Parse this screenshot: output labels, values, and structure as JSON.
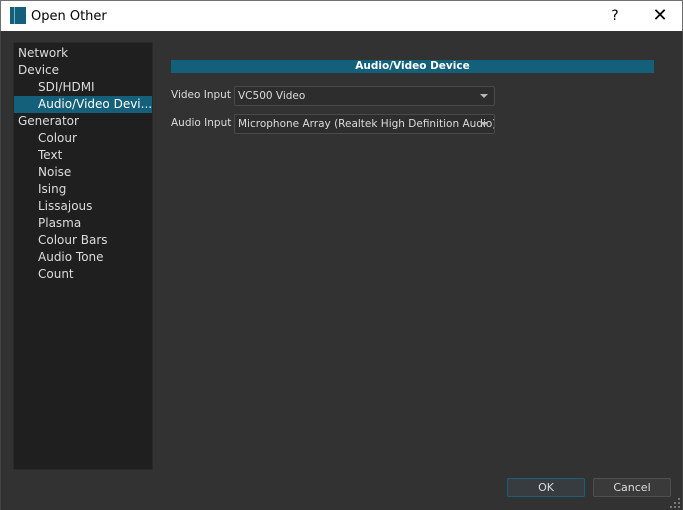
{
  "window": {
    "title": "Open Other",
    "help_label": "?",
    "close_label": "✕",
    "icon": "app-book-icon"
  },
  "tree": {
    "items": [
      {
        "label": "Network",
        "level": 0,
        "selected": false
      },
      {
        "label": "Device",
        "level": 0,
        "selected": false
      },
      {
        "label": "SDI/HDMI",
        "level": 1,
        "selected": false
      },
      {
        "label": "Audio/Video Devi...",
        "level": 1,
        "selected": true
      },
      {
        "label": "Generator",
        "level": 0,
        "selected": false
      },
      {
        "label": "Colour",
        "level": 1,
        "selected": false
      },
      {
        "label": "Text",
        "level": 1,
        "selected": false
      },
      {
        "label": "Noise",
        "level": 1,
        "selected": false
      },
      {
        "label": "Ising",
        "level": 1,
        "selected": false
      },
      {
        "label": "Lissajous",
        "level": 1,
        "selected": false
      },
      {
        "label": "Plasma",
        "level": 1,
        "selected": false
      },
      {
        "label": "Colour Bars",
        "level": 1,
        "selected": false
      },
      {
        "label": "Audio Tone",
        "level": 1,
        "selected": false
      },
      {
        "label": "Count",
        "level": 1,
        "selected": false
      }
    ]
  },
  "panel": {
    "header": "Audio/Video Device",
    "video_input": {
      "label": "Video Input",
      "value": "VC500 Video"
    },
    "audio_input": {
      "label": "Audio Input",
      "value": "Microphone Array (Realtek High Definition Audio)"
    }
  },
  "buttons": {
    "ok": "OK",
    "cancel": "Cancel"
  },
  "colors": {
    "accent": "#145f7a",
    "background": "#323232",
    "tree_background": "#1f1f1f"
  }
}
